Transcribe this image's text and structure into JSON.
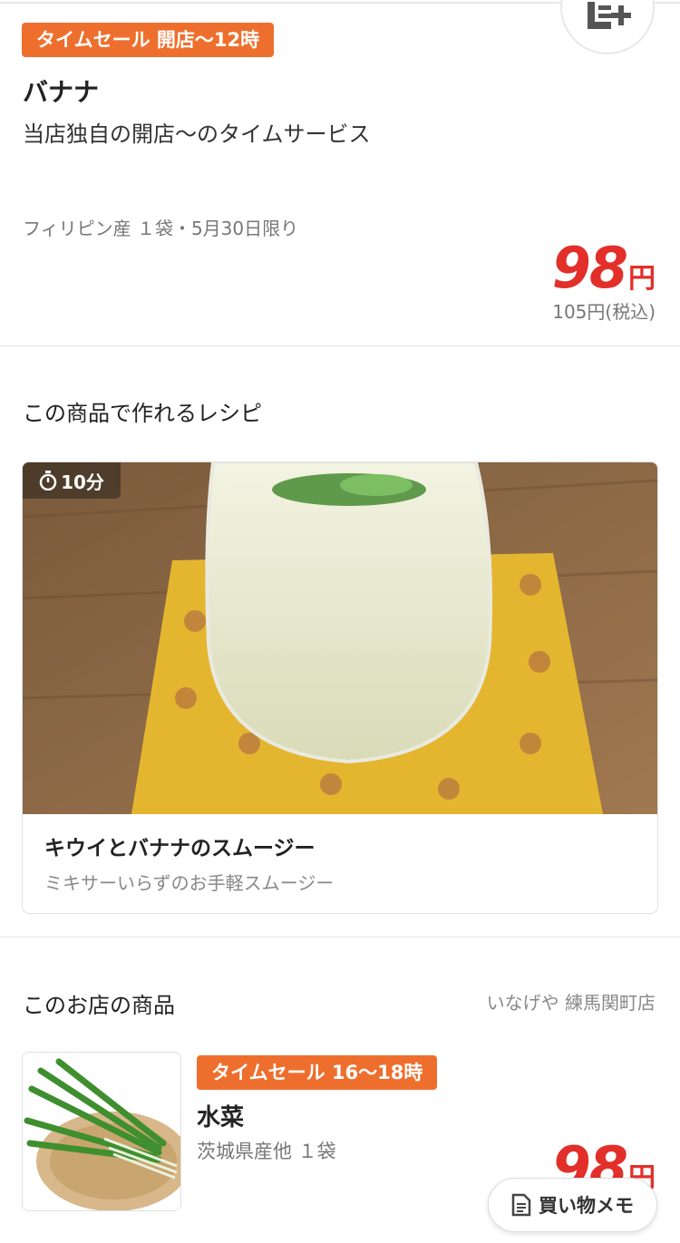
{
  "colors": {
    "accent": "#ee6f2d",
    "price": "#e22f2a"
  },
  "product": {
    "badge": "タイムセール 開店〜12時",
    "name": "バナナ",
    "description": "当店独自の開店〜のタイムサービス",
    "meta": "フィリピン産 １袋・5月30日限り",
    "price": "98",
    "price_unit": "円",
    "tax_price": "105円(税込)",
    "add_memo_icon": "list-add-icon"
  },
  "recipe_section": {
    "title": "この商品で作れるレシピ",
    "recipe": {
      "time": "10分",
      "time_icon": "stopwatch-icon",
      "title": "キウイとバナナのスムージー",
      "subtitle": "ミキサーいらずのお手軽スムージー"
    }
  },
  "store_section": {
    "title": "このお店の商品",
    "store_name": "いなげや 練馬関町店",
    "items": [
      {
        "badge": "タイムセール 16〜18時",
        "name": "水菜",
        "meta": "茨城県産他 １袋",
        "price": "98",
        "price_unit": "円"
      }
    ]
  },
  "floating_button": {
    "label": "買い物メモ",
    "icon": "memo-document-icon"
  }
}
